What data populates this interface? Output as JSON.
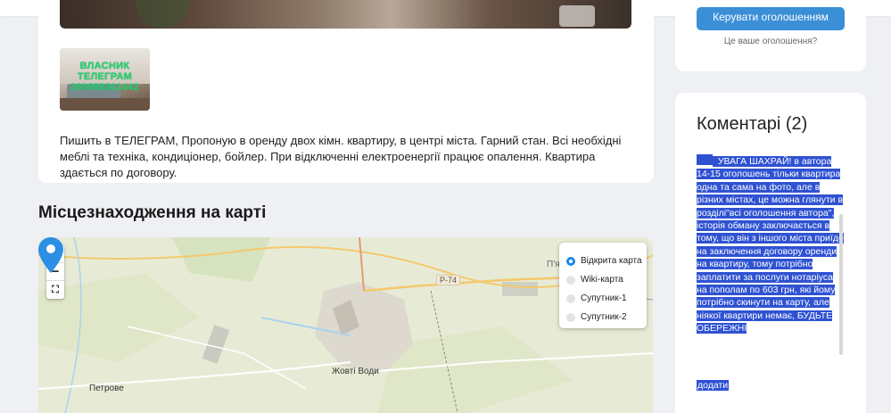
{
  "listing": {
    "thumb_watermark": [
      "ВЛАСНИК",
      "ТЕЛЕГРАМ",
      "380988361442"
    ],
    "description": "Пишить в ТЕЛЕГРАМ, Пропоную в оренду двох кімн. квартиру, в центрі міста. Гарний стан. Всі необхідні меблі та техніка, кондиціонер, бойлер. При відключенні електроенергії працює опалення. Квартира здається по договору."
  },
  "map_section": {
    "title": "Місцезнаходження на карті",
    "zoom_in": "+",
    "zoom_out": "−",
    "fullscreen": "⛶",
    "layers": [
      {
        "label": "Відкрита карта",
        "selected": true
      },
      {
        "label": "Wiki-карта",
        "selected": false
      },
      {
        "label": "Супутник-1",
        "selected": false
      },
      {
        "label": "Супутник-2",
        "selected": false
      }
    ],
    "labels": {
      "city": "Жовті Води",
      "village": "Петрове",
      "road": "Р-74",
      "edge": "П'я"
    }
  },
  "sidebar": {
    "manage_button": "Керувати оголошенням",
    "your_ad_link": "Це ваше оголошення?",
    "comments_title": "Коментарі (2)",
    "comment_text": "УВАГА ШАХРАЙ! в автора 14-15 оголошень тільки квартира одна та сама на фото, але в різних містах, це можна глянути в розділі\"всі оголошення автора\", історія обману заключається в тому, що він з іншого міста приїде на заключення договору оренди на квартиру, тому потрібно заплатити за послуги нотаріуса на пополам по 603 грн, які йому потрібно скинути на карту, але ніякої квартири немає, БУДЬТЕ ОБЕРЕЖНІ",
    "add_link": "додати"
  },
  "colors": {
    "accent": "#3a8fd6",
    "selection": "#2f52d2",
    "pin": "#2b8fe3",
    "radio": "#1e88e5"
  }
}
